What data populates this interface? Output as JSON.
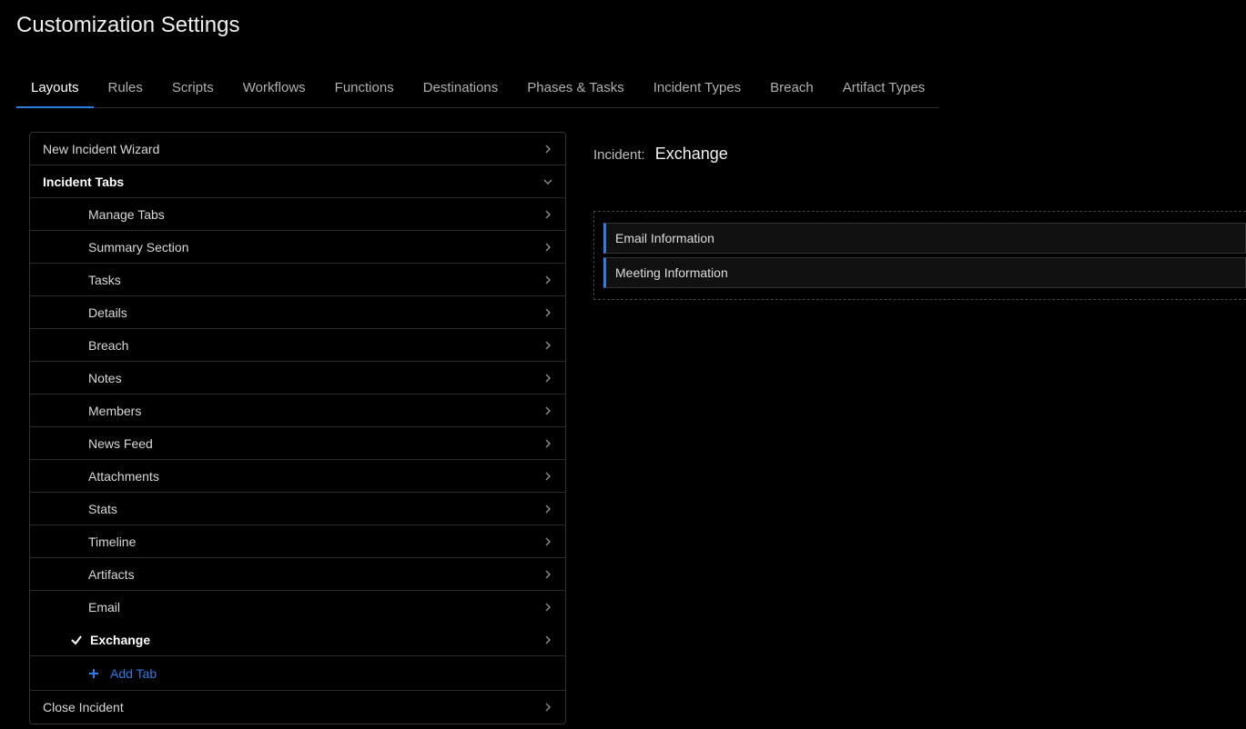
{
  "page_title": "Customization Settings",
  "tabs": [
    {
      "label": "Layouts",
      "active": true
    },
    {
      "label": "Rules",
      "active": false
    },
    {
      "label": "Scripts",
      "active": false
    },
    {
      "label": "Workflows",
      "active": false
    },
    {
      "label": "Functions",
      "active": false
    },
    {
      "label": "Destinations",
      "active": false
    },
    {
      "label": "Phases & Tasks",
      "active": false
    },
    {
      "label": "Incident Types",
      "active": false
    },
    {
      "label": "Breach",
      "active": false
    },
    {
      "label": "Artifact Types",
      "active": false
    }
  ],
  "sidebar": {
    "new_incident_wizard": "New Incident Wizard",
    "incident_tabs": "Incident Tabs",
    "children": [
      {
        "label": "Manage Tabs"
      },
      {
        "label": "Summary Section"
      },
      {
        "label": "Tasks"
      },
      {
        "label": "Details"
      },
      {
        "label": "Breach"
      },
      {
        "label": "Notes"
      },
      {
        "label": "Members"
      },
      {
        "label": "News Feed"
      },
      {
        "label": "Attachments"
      },
      {
        "label": "Stats"
      },
      {
        "label": "Timeline"
      },
      {
        "label": "Artifacts"
      },
      {
        "label": "Email"
      }
    ],
    "selected_child": {
      "label": "Exchange"
    },
    "add_tab": "Add Tab",
    "close_incident": "Close Incident"
  },
  "main": {
    "header_prefix": "Incident:",
    "header_title": "Exchange",
    "sections": [
      {
        "label": "Email Information"
      },
      {
        "label": "Meeting Information"
      }
    ]
  }
}
